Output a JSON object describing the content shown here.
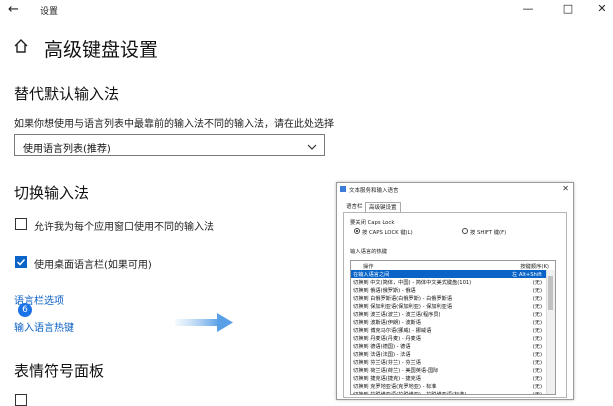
{
  "window": {
    "title": "设置",
    "back_icon": "back-arrow-icon",
    "controls": [
      "minimize-icon",
      "maximize-icon",
      "close-icon"
    ]
  },
  "page": {
    "title": "高级键盘设置",
    "home_icon": "home-icon"
  },
  "override": {
    "title": "替代默认输入法",
    "desc": "如果你想使用与语言列表中最靠前的输入法不同的输入法，请在此处选择",
    "select_value": "使用语言列表(推荐)"
  },
  "switching": {
    "title": "切换输入法",
    "option1": {
      "label": "允许我为每个应用窗口使用不同的输入法",
      "checked": false
    },
    "option2": {
      "label": "使用桌面语言栏(如果可用)",
      "checked": true
    },
    "link1": "语言栏选项",
    "link2": "输入语言热键",
    "badge": "6"
  },
  "emoji": {
    "title": "表情符号面板"
  },
  "dialog": {
    "title": "文本服务和输入语言",
    "tabs": [
      "语言栏",
      "高级键设置"
    ],
    "capslock_group": "要关闭 Caps Lock",
    "radio1": "按 CAPS LOCK 键(L)",
    "radio2": "按 SHIFT 键(F)",
    "hotkeys_group": "输入语言的热键",
    "col_action": "操作",
    "col_key": "按键顺序(K)",
    "rows": [
      {
        "action": "在输入语言之间",
        "key": "左 Alt+Shift"
      },
      {
        "action": "切换到 中文(简体，中国) - 简体中文美式键盘(101)",
        "key": "(无)"
      },
      {
        "action": "切换到 俄语(俄罗斯) - 俄语",
        "key": "(无)"
      },
      {
        "action": "切换到 白俄罗斯语(白俄罗斯) - 白俄罗斯语",
        "key": "(无)"
      },
      {
        "action": "切换到 保加利亚语(保加利亚) - 保加利亚语",
        "key": "(无)"
      },
      {
        "action": "切换到 波兰语(波兰) - 波兰语(程序员)",
        "key": "(无)"
      },
      {
        "action": "切换到 波斯语(伊朗) - 波斯语",
        "key": "(无)"
      },
      {
        "action": "切换到 博克马尔语(挪威) - 挪威语",
        "key": "(无)"
      },
      {
        "action": "切换到 丹麦语(丹麦) - 丹麦语",
        "key": "(无)"
      },
      {
        "action": "切换到 德语(德国) - 德语",
        "key": "(无)"
      },
      {
        "action": "切换到 法语(法国) - 法语",
        "key": "(无)"
      },
      {
        "action": "切换到 芬兰语(芬兰) - 芬兰语",
        "key": "(无)"
      },
      {
        "action": "切换到 荷兰语(荷兰) - 美国英语-国际",
        "key": "(无)"
      },
      {
        "action": "切换到 捷克语(捷克) - 捷克语",
        "key": "(无)"
      },
      {
        "action": "切换到 克罗地亚语(克罗地亚) - 标准",
        "key": "(无)"
      },
      {
        "action": "切换到 拉脱维亚语(拉脱维亚) - 拉脱维亚语(标准)",
        "key": "(无)"
      }
    ]
  }
}
